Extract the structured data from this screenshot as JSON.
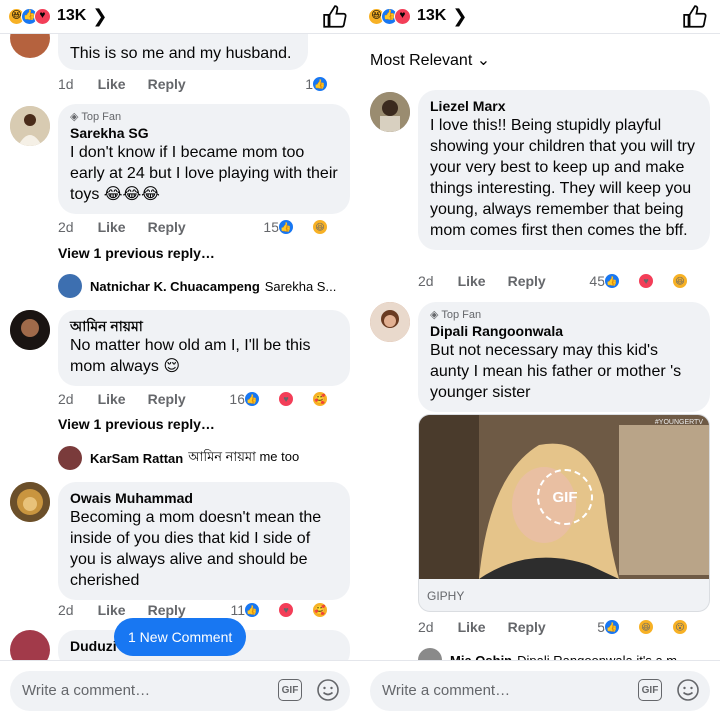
{
  "left": {
    "reaction_count": "13K",
    "new_comment_label": "1 New Comment",
    "composer_placeholder": "Write a comment…",
    "gif_label": "GIF",
    "comments": [
      {
        "text": "This is so me and my husband.",
        "time": "1d",
        "like": "Like",
        "reply": "Reply",
        "reactions": "1"
      },
      {
        "badge": "Top Fan",
        "author": "Sarekha SG",
        "text": "I don't know if I became mom too early at 24 but I love playing with their toys 😂😂😂",
        "time": "2d",
        "like": "Like",
        "reply": "Reply",
        "reactions": "15"
      },
      {
        "author": "আমিন নায়মা",
        "text": "No matter how old am I, I'll be this mom always 😌",
        "time": "2d",
        "like": "Like",
        "reply": "Reply",
        "reactions": "16"
      },
      {
        "author": "Owais Muhammad",
        "text": "Becoming a mom doesn't mean the inside of you dies that kid I side of you is always alive and should be cherished",
        "time": "2d",
        "like": "Like",
        "reply": "Reply",
        "reactions": "11"
      },
      {
        "author": "Duduzi"
      }
    ],
    "view_previous": "View 1 previous reply…",
    "replies": [
      {
        "name": "Natnichar K. Chuacampeng",
        "text": "Sarekha S..."
      },
      {
        "name": "KarSam Rattan",
        "text": "আমিন নায়মা me too"
      }
    ]
  },
  "right": {
    "reaction_count": "13K",
    "sort_label": "Most Relevant",
    "composer_placeholder": "Write a comment…",
    "gif_label": "GIF",
    "comments": [
      {
        "author": "Liezel Marx",
        "text": "I love this!! Being stupidly playful showing your children that you will try your very best to keep up and make things interesting. They will keep you young, always remember that being mom comes first then comes the bff.",
        "time": "2d",
        "like": "Like",
        "reply": "Reply",
        "reactions": "45"
      },
      {
        "badge": "Top Fan",
        "author": "Dipali Rangoonwala",
        "text": "But not necessary may this kid's aunty I mean his father or mother 's younger sister",
        "time": "2d",
        "like": "Like",
        "reply": "Reply",
        "reactions": "5"
      }
    ],
    "giphy": {
      "source": "GIPHY",
      "badge": "GIF",
      "watermark": "#YOUNGERTV"
    },
    "partial_reply": {
      "name": "Mia Oshin",
      "text": "Dipali Rangoonwala it's a m"
    }
  },
  "icons": [
    "haha-reaction-icon",
    "like-reaction-icon",
    "love-reaction-icon",
    "wow-reaction-icon",
    "care-reaction-icon",
    "thumbs-up-icon",
    "chevron-right-icon",
    "chevron-down-icon",
    "gif-icon",
    "smiley-icon"
  ],
  "colors": {
    "accent": "#1877f2",
    "bubble": "#f0f2f5",
    "secondary_text": "#65676b"
  }
}
